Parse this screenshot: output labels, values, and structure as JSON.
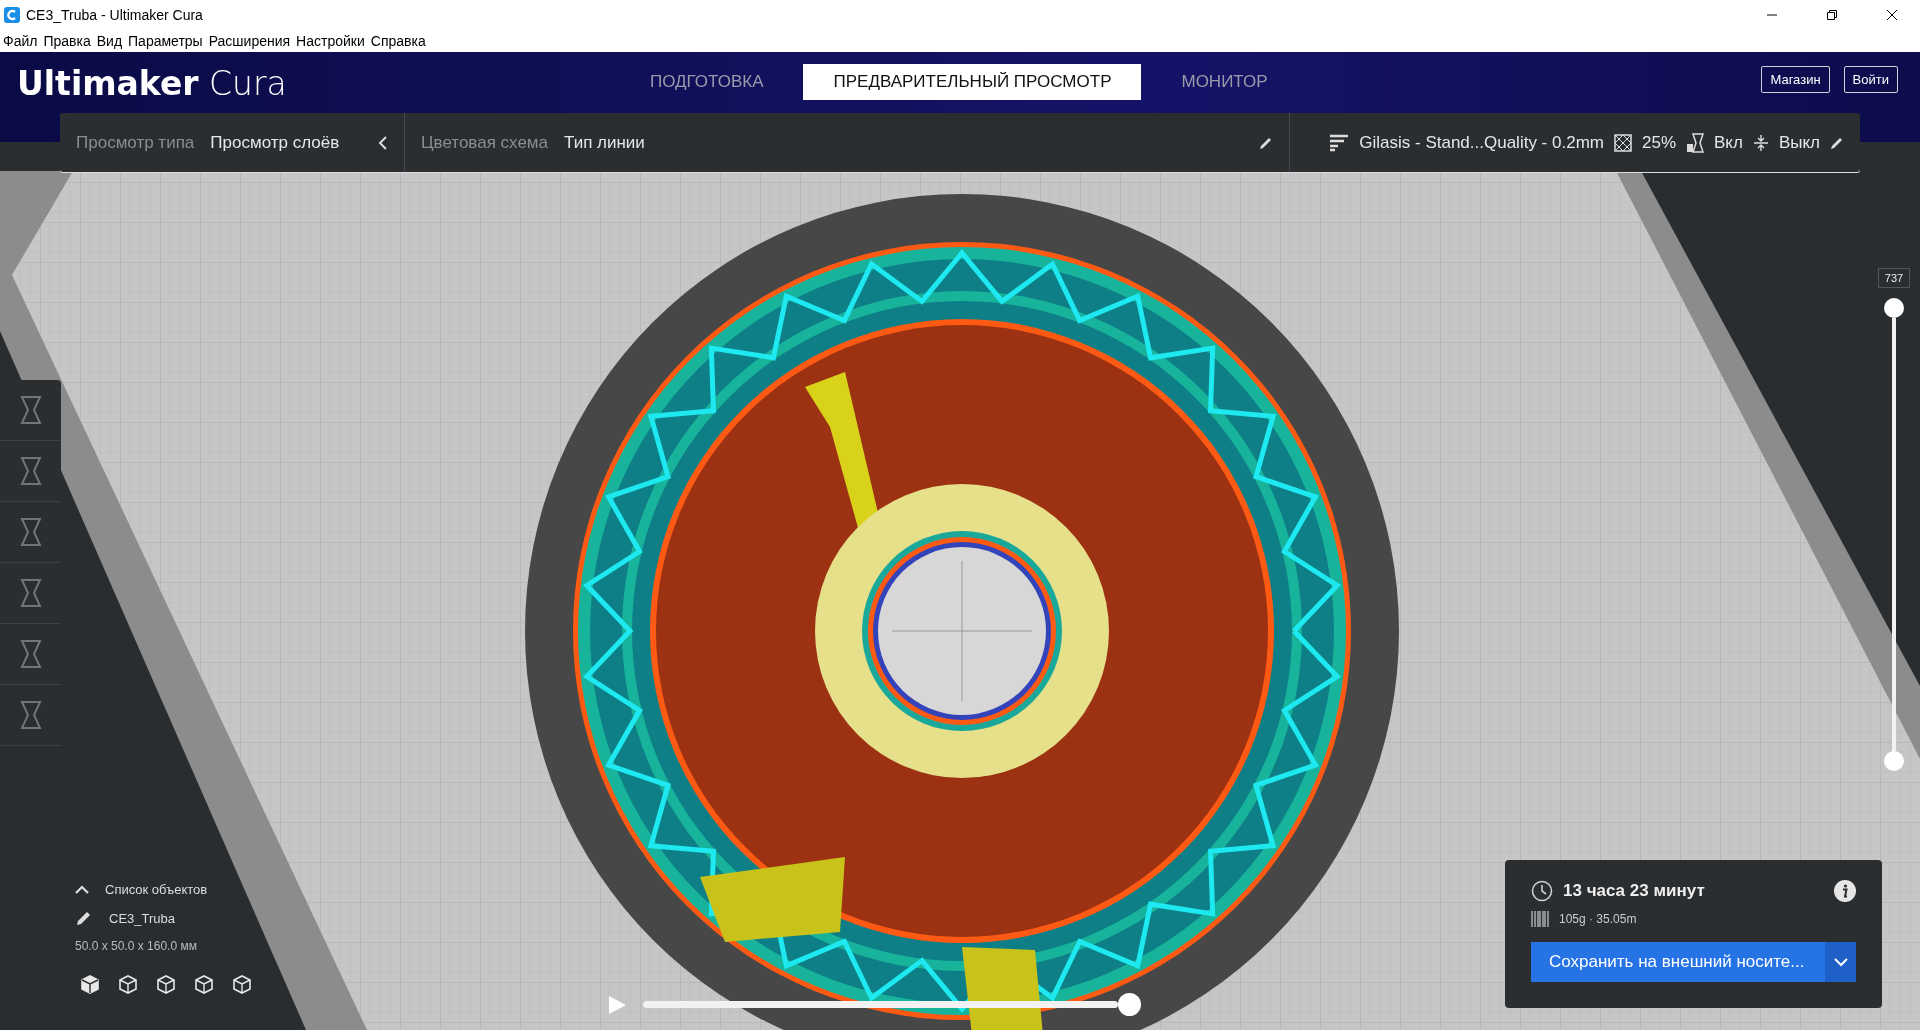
{
  "window": {
    "title": "CE3_Truba - Ultimaker Cura"
  },
  "menu": [
    "Файл",
    "Правка",
    "Вид",
    "Параметры",
    "Расширения",
    "Настройки",
    "Справка"
  ],
  "header": {
    "logo_bold": "Ultimaker",
    "logo_light": "Cura",
    "tabs": [
      {
        "label": "ПОДГОТОВКА",
        "selected": false
      },
      {
        "label": "ПРЕДВАРИТЕЛЬНЫЙ ПРОСМОТР",
        "selected": true
      },
      {
        "label": "МОНИТОР",
        "selected": false
      }
    ],
    "buttons": [
      "Магазин",
      "Войти"
    ]
  },
  "view_bar": {
    "view_type": {
      "label": "Просмотр типа",
      "value": "Просмотр слоёв"
    },
    "color_scheme": {
      "label": "Цветовая схема",
      "value": "Тип линии"
    }
  },
  "print_setup": {
    "profile": "Gilasis - Stand...Quality - 0.2mm",
    "infill": "25%",
    "support": "Вкл",
    "adhesion": "Выкл"
  },
  "object_list": {
    "title": "Список объектов",
    "object": "CE3_Truba",
    "dimensions": "50.0 x 50.0 x 160.0 мм"
  },
  "layer_slider": {
    "value": "737",
    "level": 1
  },
  "path_slider": {
    "level": 1
  },
  "print_info": {
    "time": "13 часа 23 минут",
    "material": "105g · 35.05m",
    "button": "Сохранить на внешний носите..."
  }
}
